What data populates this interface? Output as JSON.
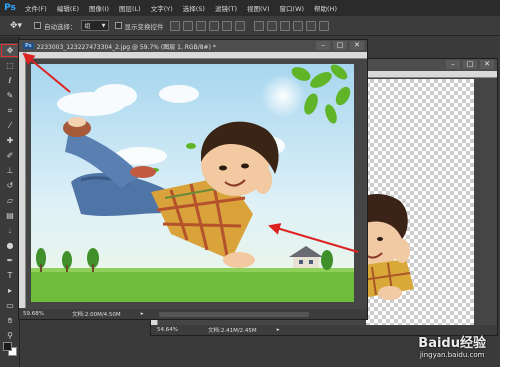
{
  "app": {
    "logo": "Ps"
  },
  "menu": [
    "文件(F)",
    "编辑(E)",
    "图像(I)",
    "图层(L)",
    "文字(Y)",
    "选择(S)",
    "滤镜(T)",
    "视图(V)",
    "窗口(W)",
    "帮助(H)"
  ],
  "options": {
    "auto_select_label": "自动选择：",
    "auto_select_value": "组",
    "transform_label": "显示变换控件"
  },
  "tools": [
    "move-tool",
    "marquee-tool",
    "lasso-tool",
    "quick-select-tool",
    "crop-tool",
    "eyedropper-tool",
    "healing-brush-tool",
    "brush-tool",
    "clone-stamp-tool",
    "history-brush-tool",
    "eraser-tool",
    "gradient-tool",
    "blur-tool",
    "dodge-tool",
    "pen-tool",
    "type-tool",
    "path-select-tool",
    "rectangle-tool",
    "hand-tool",
    "zoom-tool"
  ],
  "colors": {
    "foreground": "#1a1a1a",
    "background": "#ffffff",
    "arrow": "#dd2222",
    "sky": "#cfe9f7",
    "grass": "#6fbb3c"
  },
  "doc_front": {
    "title": "2233003_123227473304_2.jpg @ 59.7% (图层 1, RGB/8#) *",
    "zoom": "59.68%",
    "doc_info": "文档:2.00M/4.50M"
  },
  "doc_back": {
    "zoom": "54.64%",
    "doc_info": "文档:2.41M/2.45M"
  },
  "watermark": {
    "main": "Baidu经验",
    "sub": "jingyan.baidu.com"
  }
}
